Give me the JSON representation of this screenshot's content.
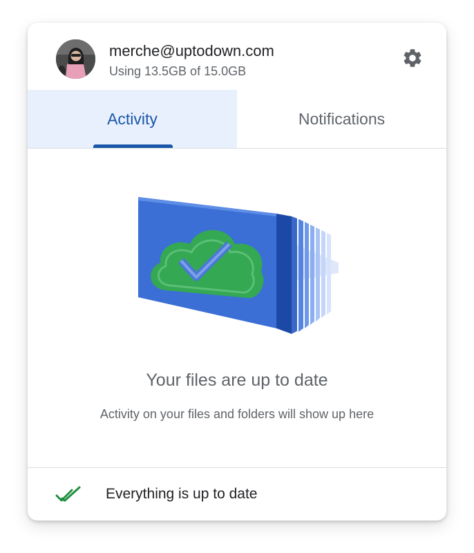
{
  "account": {
    "email": "merche@uptodown.com",
    "storage": "Using 13.5GB of 15.0GB"
  },
  "tabs": [
    {
      "label": "Activity",
      "selected": true
    },
    {
      "label": "Notifications",
      "selected": false
    }
  ],
  "main": {
    "title": "Your files are up to date",
    "description": "Activity on your files and folders will show up here"
  },
  "footer": {
    "status": "Everything is up to date"
  },
  "colors": {
    "accent": "#1a56a8",
    "tab_selected_bg": "#e8f0fe",
    "illustration_blue": "#3b6fd6",
    "illustration_green": "#34a853"
  },
  "icons": {
    "settings": "gear-icon",
    "footer": "double-check-icon",
    "illustration": "cloud-check-illustration"
  }
}
